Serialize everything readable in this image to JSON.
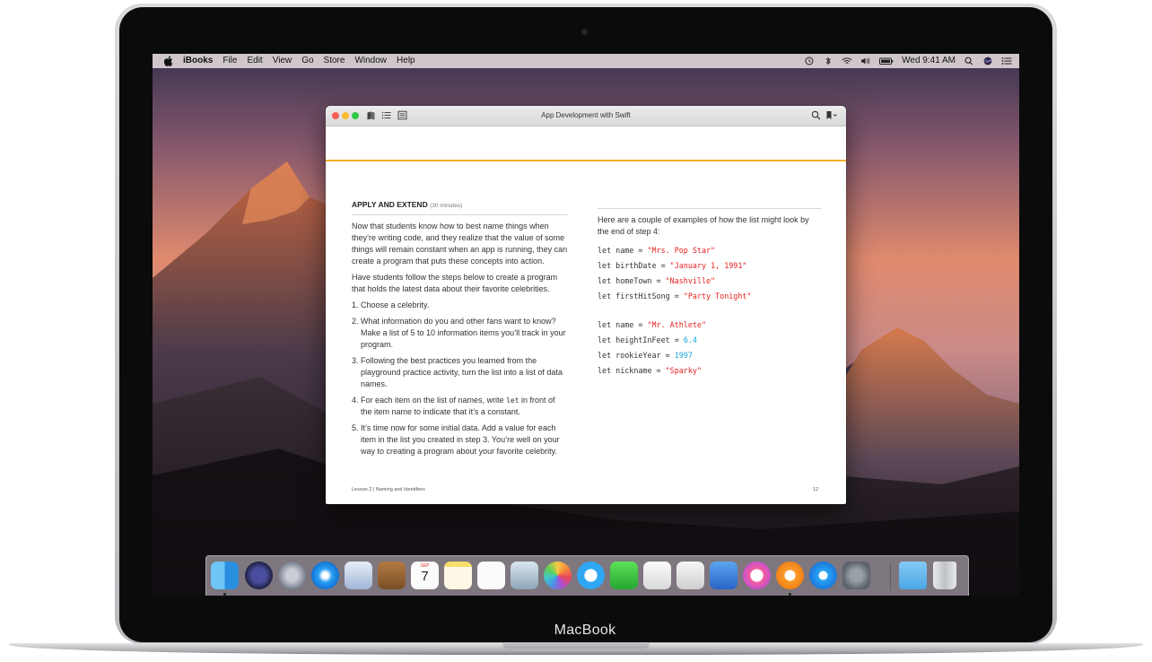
{
  "device": {
    "brand_label": "MacBook"
  },
  "menubar": {
    "app_name": "iBooks",
    "items": [
      "File",
      "Edit",
      "View",
      "Go",
      "Store",
      "Window",
      "Help"
    ],
    "clock": "Wed 9:41 AM",
    "status_icons": [
      "time-machine-icon",
      "bluetooth-icon",
      "wifi-icon",
      "volume-icon",
      "battery-icon",
      "spotlight-icon",
      "siri-icon",
      "notification-center-icon"
    ]
  },
  "window": {
    "title": "App Development with Swift",
    "toolbar_icons": [
      "library-icon",
      "table-of-contents-icon",
      "notes-icon",
      "search-icon",
      "bookmark-icon"
    ]
  },
  "page": {
    "section_title": "APPLY AND EXTEND",
    "section_duration": "(30 minutes)",
    "intro_paragraphs": [
      "Now that students know how to best name things when they’re writing code, and they realize that the value of some things will remain constant when an app is running, they can create a program that puts these concepts into action.",
      "Have students follow the steps below to create a program that holds the latest data about their favorite celebrities."
    ],
    "steps": [
      {
        "num": "1.",
        "text": "Choose a celebrity."
      },
      {
        "num": "2.",
        "text": "What information do you and other fans want to know? Make a list of 5 to 10 information items you’ll track in your program."
      },
      {
        "num": "3.",
        "text": "Following the best practices you learned from the playground practice activity, turn the list into a list of data names."
      },
      {
        "num": "4.",
        "text_before": "For each item on the list of names, write ",
        "code": "let",
        "text_after": " in front of the item name to indicate that it’s a constant."
      },
      {
        "num": "5.",
        "text": "It’s time now for some initial data. Add a value for each item in the list you created in step 3. You’re well on your way to creating a program about your favorite celebrity."
      }
    ],
    "examples_intro": "Here are a couple of examples of how the list might look by the end of step 4:",
    "code_group_1": [
      {
        "prefix": "let name = ",
        "value": "\"Mrs. Pop Star\"",
        "kind": "string"
      },
      {
        "prefix": "let birthDate = ",
        "value": "\"January 1, 1991\"",
        "kind": "string"
      },
      {
        "prefix": "let homeTown = ",
        "value": "\"Nashville\"",
        "kind": "string"
      },
      {
        "prefix": "let firstHitSong = ",
        "value": "\"Party Tonight\"",
        "kind": "string"
      }
    ],
    "code_group_2": [
      {
        "prefix": "let name = ",
        "value": "\"Mr. Athlete\"",
        "kind": "string"
      },
      {
        "prefix": "let heightInFeet = ",
        "value": "6.4",
        "kind": "number"
      },
      {
        "prefix": "let rookieYear = ",
        "value": "1997",
        "kind": "number"
      },
      {
        "prefix": "let nickname = ",
        "value": "\"Sparky\"",
        "kind": "string"
      }
    ],
    "footer_left": "Lesson 2 | Naming and Identifiers",
    "page_number": "12"
  },
  "dock": {
    "calendar": {
      "month": "SEP",
      "day": "7"
    },
    "apps": [
      "finder-icon",
      "siri-icon",
      "launchpad-icon",
      "safari-icon",
      "mail-icon",
      "contacts-icon",
      "calendar-icon",
      "notes-icon",
      "reminders-icon",
      "preview-icon",
      "photos-icon",
      "messages-icon",
      "facetime-icon",
      "pages-icon",
      "numbers-icon",
      "keynote-icon",
      "itunes-icon",
      "ibooks-icon",
      "app-store-icon",
      "system-preferences-icon",
      "downloads-folder-icon",
      "trash-icon"
    ]
  },
  "colors": {
    "accent_rule": "#f2b12a",
    "code_string": "#e4201f",
    "code_number": "#17a3d9"
  }
}
